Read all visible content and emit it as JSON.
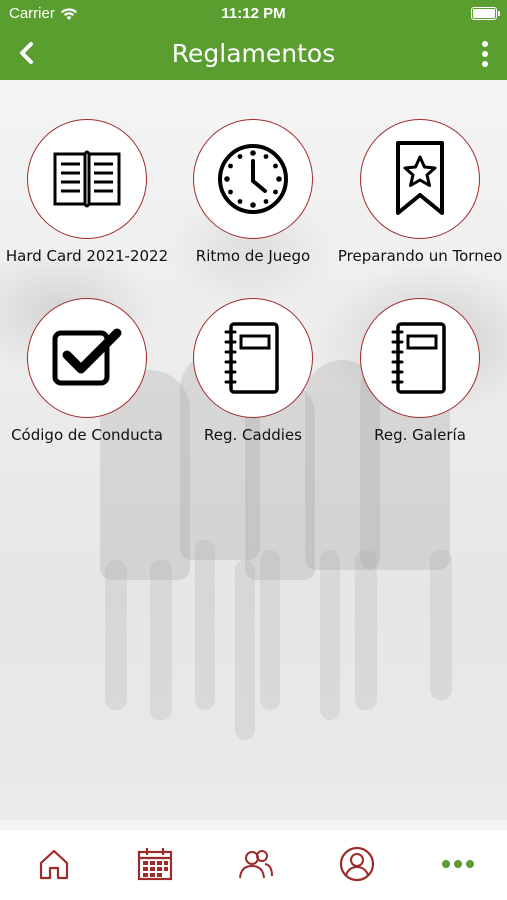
{
  "status_bar": {
    "carrier": "Carrier",
    "time": "11:12 PM"
  },
  "nav": {
    "title": "Reglamentos",
    "back_icon": "chevron-left-icon",
    "more_icon": "more-vertical-icon"
  },
  "items": [
    {
      "label": "Hard Card 2021-2022",
      "icon": "open-book-icon"
    },
    {
      "label": "Ritmo de Juego",
      "icon": "clock-icon"
    },
    {
      "label": "Preparando un Torneo",
      "icon": "star-bookmark-icon"
    },
    {
      "label": "Código de Conducta",
      "icon": "checkbox-icon"
    },
    {
      "label": "Reg. Caddies",
      "icon": "notebook-icon"
    },
    {
      "label": "Reg. Galería",
      "icon": "notebook-icon"
    }
  ],
  "tabs": [
    {
      "name": "home",
      "icon": "home-icon"
    },
    {
      "name": "calendar",
      "icon": "calendar-icon"
    },
    {
      "name": "people",
      "icon": "people-icon"
    },
    {
      "name": "profile",
      "icon": "profile-icon"
    },
    {
      "name": "more",
      "icon": "more-horizontal-icon"
    }
  ],
  "colors": {
    "brand_green": "#5a9e2f",
    "accent_red": "#9e2b2b",
    "active_tab": "#5a9e2f"
  }
}
